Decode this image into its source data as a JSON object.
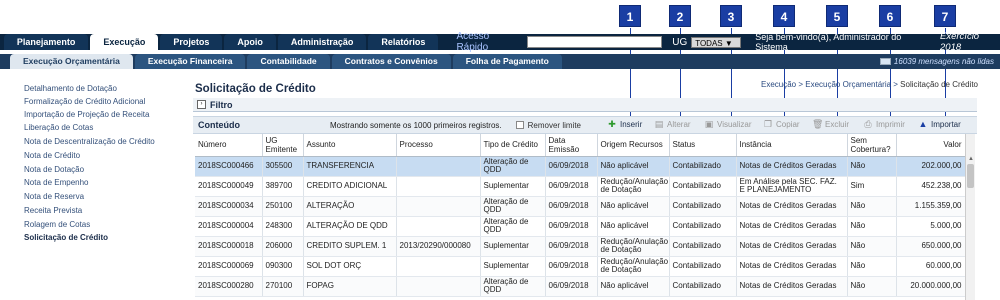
{
  "callouts": [
    "1",
    "2",
    "3",
    "4",
    "5",
    "6",
    "7"
  ],
  "topnav": {
    "tabs": [
      "Planejamento",
      "Execução",
      "Projetos",
      "Apoio",
      "Administração",
      "Relatórios"
    ],
    "quick_access_label": "Acesso Rápido",
    "ug_label": "UG",
    "ug_value": "TODAS",
    "welcome": "Seja bem-vindo(a), Administrador do Sistema",
    "exercise": "Exercício 2018"
  },
  "subnav": {
    "tabs": [
      "Execução Orçamentária",
      "Execução Financeira",
      "Contabilidade",
      "Contratos e Convênios",
      "Folha de Pagamento"
    ],
    "messages": "16039 mensagens não lidas"
  },
  "sidebar": {
    "items": [
      "Detalhamento de Dotação",
      "Formalização de Crédito Adicional",
      "Importação de Projeção de Receita",
      "Liberação de Cotas",
      "Nota de Descentralização de Crédito",
      "Nota de Crédito",
      "Nota de Dotação",
      "Nota de Empenho",
      "Nota de Reserva",
      "Receita Prevista",
      "Rolagem de Cotas",
      "Solicitação de Crédito"
    ]
  },
  "main": {
    "title": "Solicitação de Crédito",
    "breadcrumb": "Execução > Execução Orçamentária > ",
    "breadcrumb_current": "Solicitação de Crédito",
    "filter_label": "Filtro",
    "content_label": "Conteúdo",
    "showing": "Mostrando somente os 1000 primeiros registros.",
    "remove_limit": "Remover limite",
    "toolbar": [
      "Inserir",
      "Alterar",
      "Visualizar",
      "Copiar",
      "Excluir",
      "Imprimir",
      "Importar"
    ],
    "columns": [
      "Número",
      "UG Emitente",
      "Assunto",
      "Processo",
      "Tipo de Crédito",
      "Data Emissão",
      "Origem Recursos",
      "Status",
      "Instância",
      "Sem Cobertura?",
      "Valor"
    ],
    "rows": [
      [
        "2018SC000466",
        "305500",
        "TRANSFERENCIA",
        "",
        "Alteração de QDD",
        "06/09/2018",
        "Não aplicável",
        "Contabilizado",
        "Notas de Créditos Geradas",
        "Não",
        "202.000,00"
      ],
      [
        "2018SC000049",
        "389700",
        "CREDITO ADICIONAL",
        "",
        "Suplementar",
        "06/09/2018",
        "Redução/Anulação de Dotação",
        "Contabilizado",
        "Em Análise pela SEC. FAZ. E PLANEJAMENTO",
        "Sim",
        "452.238,00"
      ],
      [
        "2018SC000034",
        "250100",
        "ALTERAÇÃO",
        "",
        "Alteração de QDD",
        "06/09/2018",
        "Não aplicável",
        "Contabilizado",
        "Notas de Créditos Geradas",
        "Não",
        "1.155.359,00"
      ],
      [
        "2018SC000004",
        "248300",
        "ALTERAÇÃO DE QDD",
        "",
        "Alteração de QDD",
        "06/09/2018",
        "Não aplicável",
        "Contabilizado",
        "Notas de Créditos Geradas",
        "Não",
        "5.000,00"
      ],
      [
        "2018SC000018",
        "206000",
        "CREDITO SUPLEM. 1",
        "2013/20290/000080",
        "Suplementar",
        "06/09/2018",
        "Redução/Anulação de Dotação",
        "Contabilizado",
        "Notas de Créditos Geradas",
        "Não",
        "650.000,00"
      ],
      [
        "2018SC000069",
        "090300",
        "SOL DOT ORÇ",
        "",
        "Suplementar",
        "06/09/2018",
        "Redução/Anulação de Dotação",
        "Contabilizado",
        "Notas de Créditos Geradas",
        "Não",
        "60.000,00"
      ],
      [
        "2018SC000280",
        "270100",
        "FOPAG",
        "",
        "Alteração de QDD",
        "06/09/2018",
        "Não aplicável",
        "Contabilizado",
        "Notas de Créditos Geradas",
        "Não",
        "20.000.000,00"
      ]
    ]
  },
  "colors": {
    "nav_dark": "#0b2540",
    "subnav": "#1e3c5f",
    "callout": "#1a3ea3",
    "selected_row": "#c7dcf2"
  }
}
